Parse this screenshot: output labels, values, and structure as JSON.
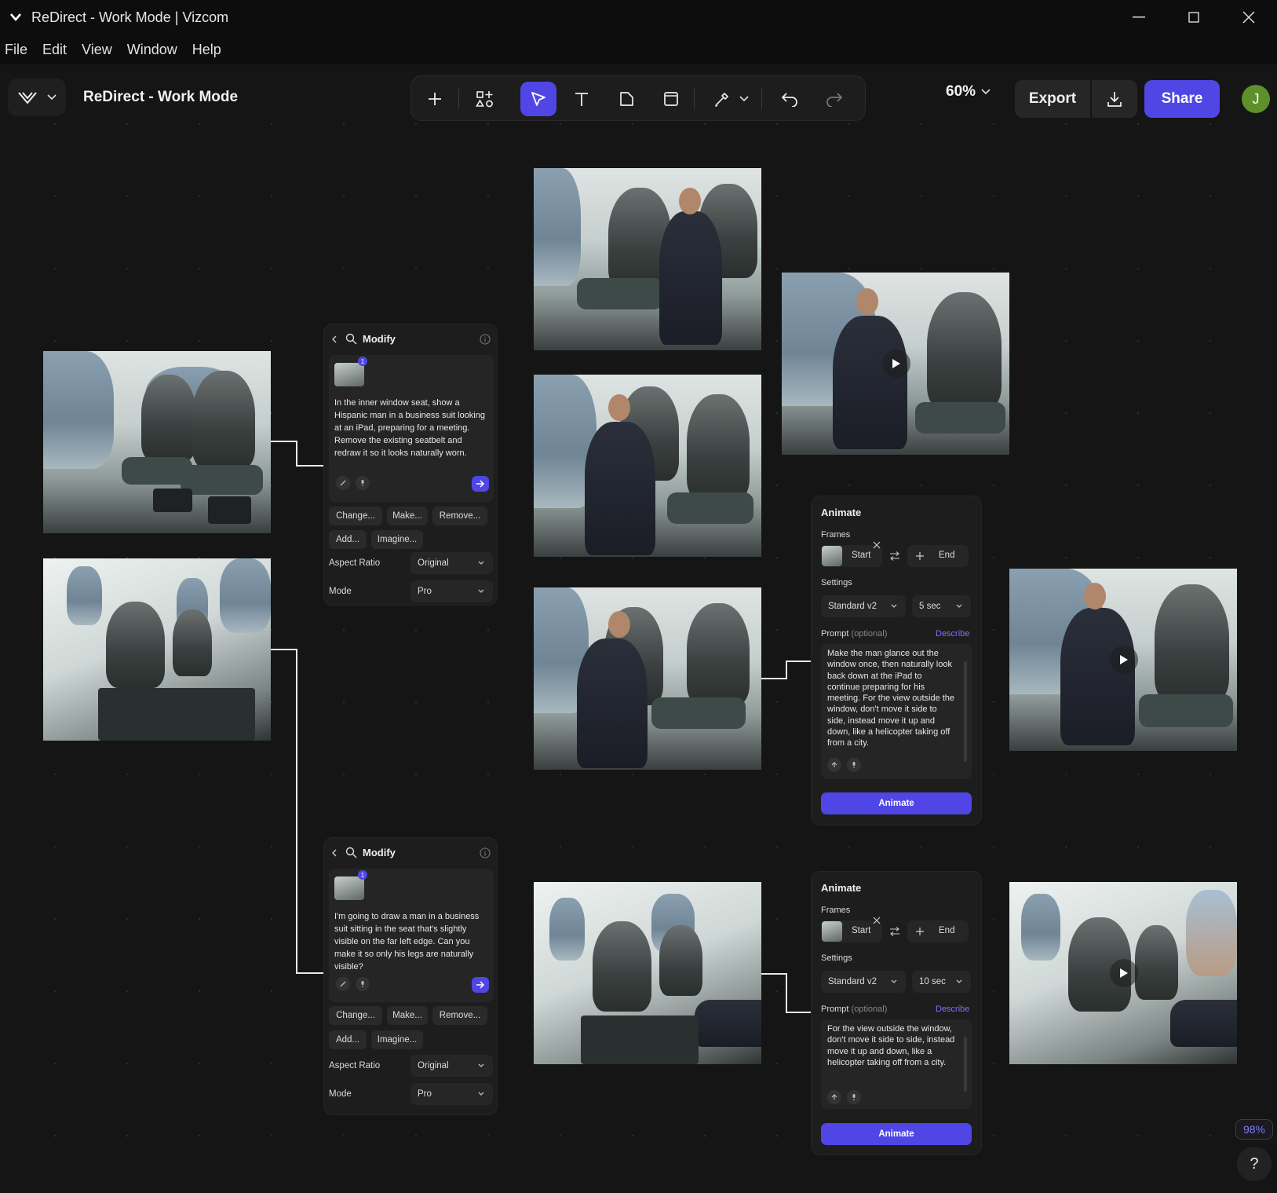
{
  "window": {
    "title": "ReDirect - Work Mode | Vizcom"
  },
  "menu": [
    "File",
    "Edit",
    "View",
    "Window",
    "Help"
  ],
  "toolbar": {
    "document_title": "ReDirect - Work Mode",
    "zoom": "60%",
    "export_label": "Export",
    "share_label": "Share",
    "avatar_initial": "J",
    "active_tool": "select-tool"
  },
  "modify_panels": [
    {
      "title": "Modify",
      "image_count_badge": "1",
      "prompt": "In the inner window seat, show a Hispanic man in a business suit looking at an iPad, preparing for a meeting. Remove the existing seatbelt and redraw it so it looks naturally worn.",
      "quick_actions": [
        "Change...",
        "Make...",
        "Remove...",
        "Add...",
        "Imagine..."
      ],
      "aspect_ratio_label": "Aspect Ratio",
      "aspect_ratio_value": "Original",
      "mode_label": "Mode",
      "mode_value": "Pro"
    },
    {
      "title": "Modify",
      "image_count_badge": "1",
      "prompt": "I'm going to draw a man in a business suit sitting in the seat that's slightly visible on the far left edge. Can you make it so only his legs are naturally visible?",
      "quick_actions": [
        "Change...",
        "Make...",
        "Remove...",
        "Add...",
        "Imagine..."
      ],
      "aspect_ratio_label": "Aspect Ratio",
      "aspect_ratio_value": "Original",
      "mode_label": "Mode",
      "mode_value": "Pro"
    }
  ],
  "animate_panels": [
    {
      "title": "Animate",
      "frames_label": "Frames",
      "start_label": "Start",
      "end_label": "End",
      "settings_label": "Settings",
      "model": "Standard v2",
      "duration": "5 sec",
      "prompt_label": "Prompt",
      "prompt_optional": "(optional)",
      "describe_label": "Describe",
      "prompt": "Make the man glance out the window once, then naturally look back down at the iPad to continue preparing for his meeting. For the view outside the window, don't move it side to side, instead move it up and down, like a helicopter taking off from a city.",
      "button_label": "Animate"
    },
    {
      "title": "Animate",
      "frames_label": "Frames",
      "start_label": "Start",
      "end_label": "End",
      "settings_label": "Settings",
      "model": "Standard v2",
      "duration": "10 sec",
      "prompt_label": "Prompt",
      "prompt_optional": "(optional)",
      "describe_label": "Describe",
      "prompt": "For the view outside the window, don't move it side to side, instead move it up and down, like a helicopter taking off from a city.",
      "button_label": "Animate"
    }
  ],
  "status": {
    "progress_badge": "98%",
    "help_label": "?"
  },
  "colors": {
    "accent": "#4f46e5",
    "canvas": "#151515",
    "panel": "#1d1d1d"
  }
}
